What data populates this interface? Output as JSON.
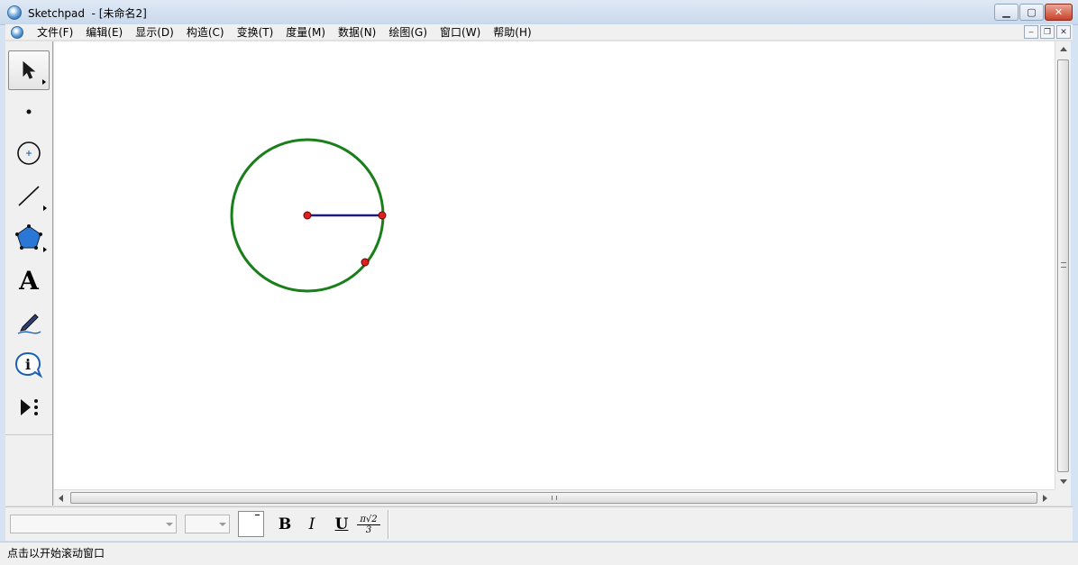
{
  "window": {
    "title": "Sketchpad  - [未命名2]"
  },
  "menu": {
    "items": [
      {
        "label": "文件(F)"
      },
      {
        "label": "编辑(E)"
      },
      {
        "label": "显示(D)"
      },
      {
        "label": "构造(C)"
      },
      {
        "label": "变换(T)"
      },
      {
        "label": "度量(M)"
      },
      {
        "label": "数据(N)"
      },
      {
        "label": "绘图(G)"
      },
      {
        "label": "窗口(W)"
      },
      {
        "label": "帮助(H)"
      }
    ]
  },
  "toolbox": {
    "tools": [
      {
        "name": "selection-arrow-tool",
        "icon": "arrow-cursor-icon",
        "selected": true
      },
      {
        "name": "point-tool",
        "icon": "point-icon"
      },
      {
        "name": "compass-tool",
        "icon": "circle-icon"
      },
      {
        "name": "straightedge-tool",
        "icon": "segment-icon"
      },
      {
        "name": "polygon-tool",
        "icon": "pentagon-icon"
      },
      {
        "name": "text-tool",
        "icon": "text-a-icon",
        "glyph": "A"
      },
      {
        "name": "marker-tool",
        "icon": "pen-icon"
      },
      {
        "name": "information-tool",
        "icon": "info-icon",
        "glyph": "i"
      },
      {
        "name": "custom-tool",
        "icon": "custom-tool-icon"
      }
    ]
  },
  "sketch": {
    "circle_color": "#1a7f1a",
    "segment_color": "#1a1a80",
    "point_color": "#e02020"
  },
  "textbar": {
    "bold_label": "B",
    "italic_label": "I",
    "underline_label": "U",
    "math_label_top": "π√2",
    "math_label_bottom": "3"
  },
  "status": {
    "text": "点击以开始滚动窗口"
  }
}
